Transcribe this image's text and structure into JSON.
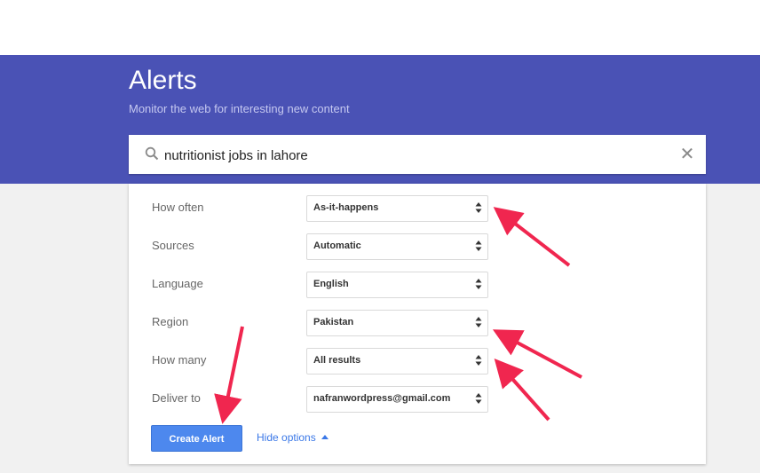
{
  "header": {
    "title": "Alerts",
    "subtitle": "Monitor the web for interesting new content"
  },
  "search": {
    "query": "nutritionist jobs in lahore",
    "clear_glyph": "✕",
    "icons": {
      "search": "search-icon",
      "clear": "close-icon"
    }
  },
  "options": {
    "rows": [
      {
        "label": "How often",
        "value": "As-it-happens"
      },
      {
        "label": "Sources",
        "value": "Automatic"
      },
      {
        "label": "Language",
        "value": "English"
      },
      {
        "label": "Region",
        "value": "Pakistan"
      },
      {
        "label": "How many",
        "value": "All results"
      },
      {
        "label": "Deliver to",
        "value": "nafranwordpress@gmail.com"
      }
    ]
  },
  "actions": {
    "create_label": "Create Alert",
    "hide_options_label": "Hide options"
  },
  "colors": {
    "hero": "#4a52b5",
    "button": "#4d88ee",
    "link": "#3b78e7",
    "annotation_arrow": "#f0264f"
  }
}
